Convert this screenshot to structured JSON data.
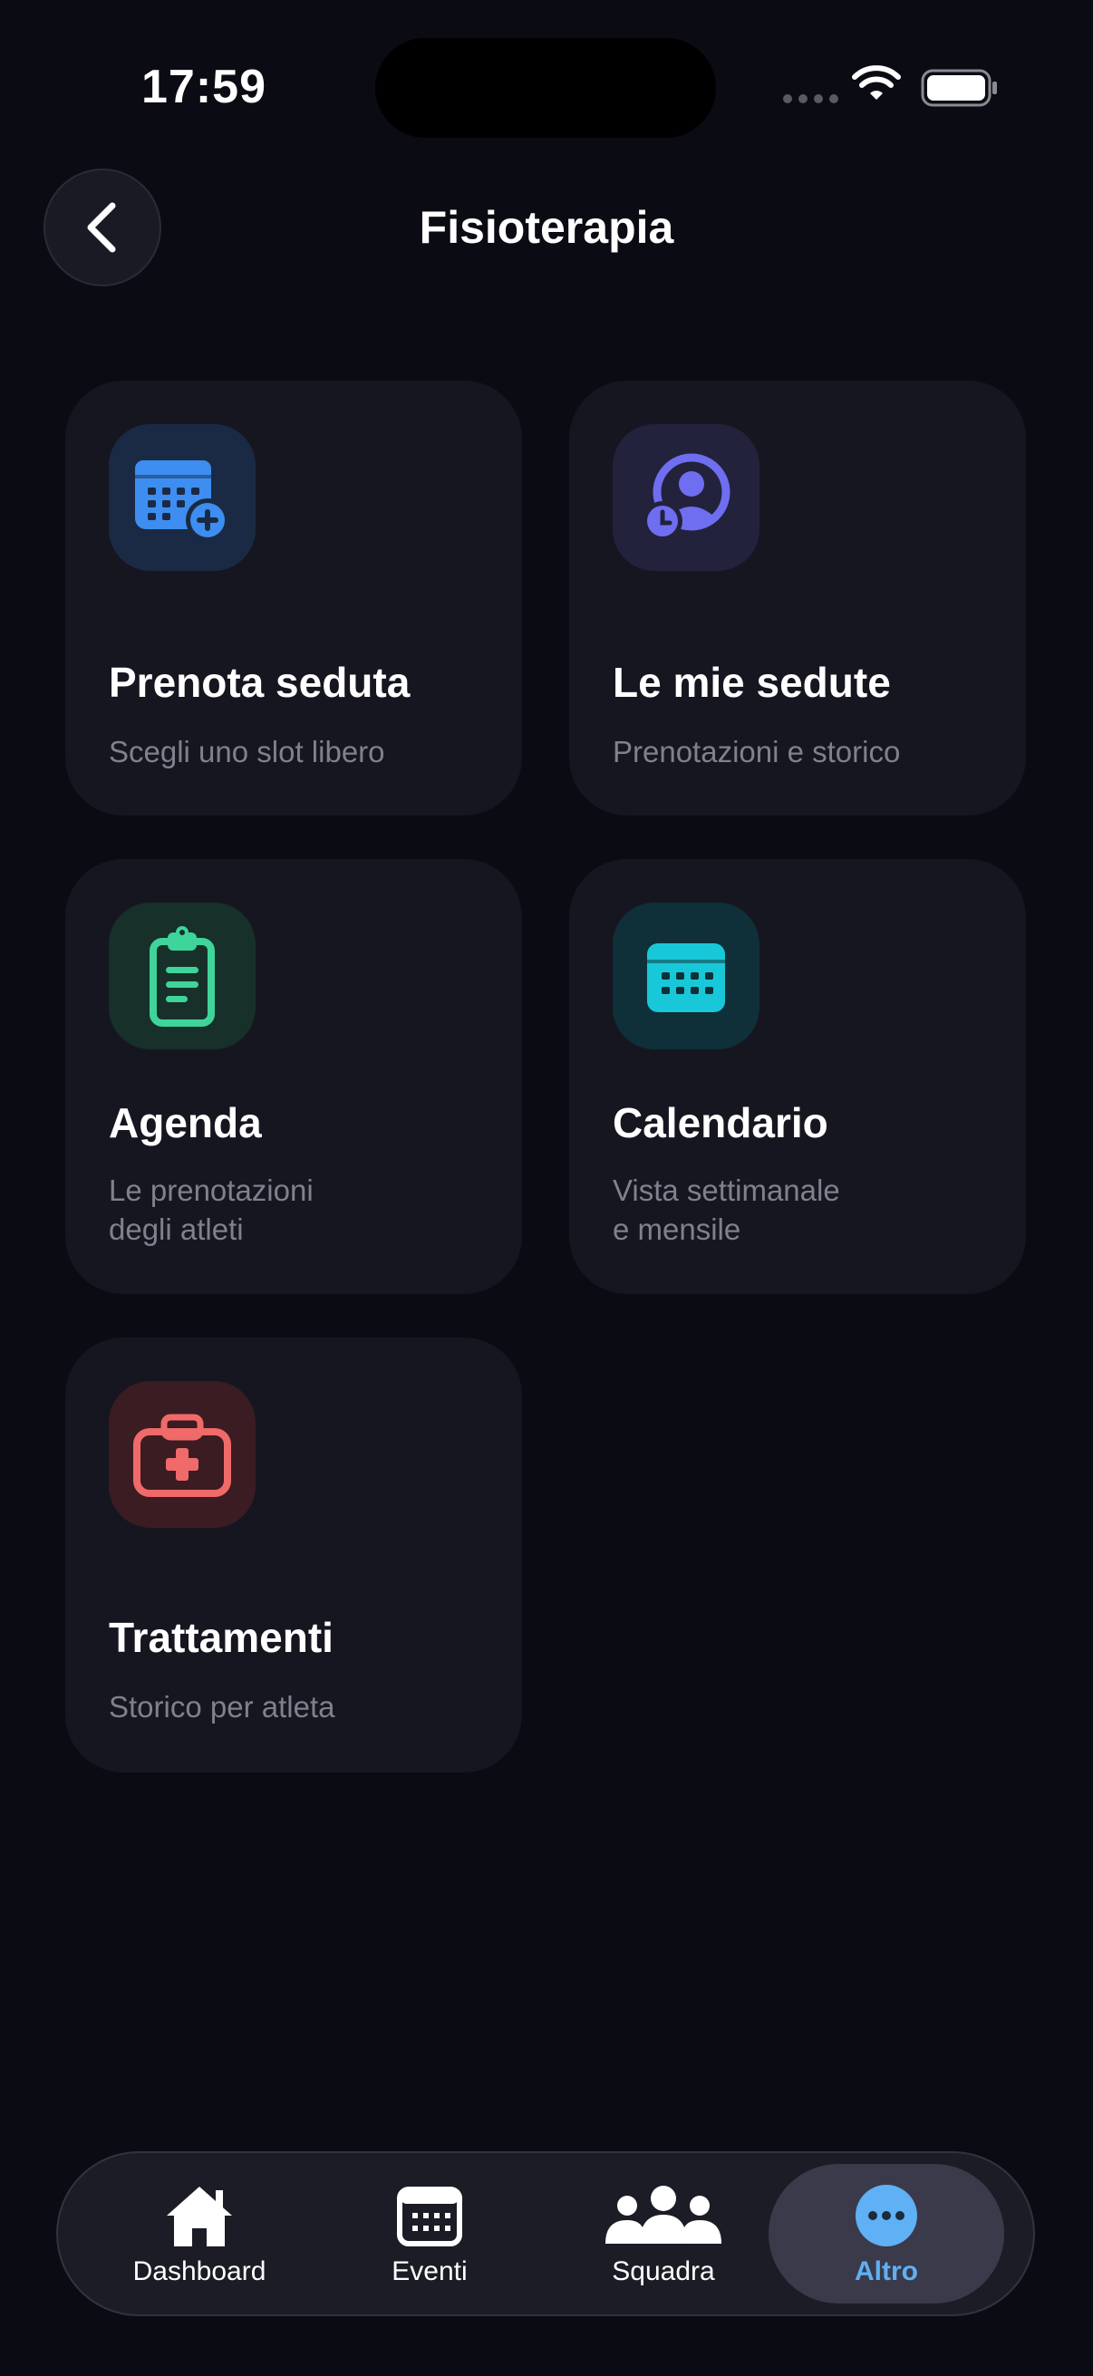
{
  "status_bar": {
    "time": "17:59"
  },
  "header": {
    "title": "Fisioterapia",
    "back_icon": "chevron-left-icon"
  },
  "cards": [
    {
      "title": "Prenota seduta",
      "subtitle": "Scegli uno slot libero",
      "icon": "calendar-plus-icon",
      "accent": "#3d8ef0"
    },
    {
      "title": "Le mie sedute",
      "subtitle": "Prenotazioni e storico",
      "icon": "user-clock-icon",
      "accent": "#6f6ef0"
    },
    {
      "title": "Agenda",
      "subtitle": "Le prenotazioni\ndegli atleti",
      "icon": "clipboard-icon",
      "accent": "#3ed49a"
    },
    {
      "title": "Calendario",
      "subtitle": "Vista settimanale\ne mensile",
      "icon": "calendar-icon",
      "accent": "#19c8d8"
    },
    {
      "title": "Trattamenti",
      "subtitle": "Storico per atleta",
      "icon": "medical-bag-icon",
      "accent": "#f06a6a"
    }
  ],
  "tab_bar": {
    "items": [
      {
        "label": "Dashboard",
        "icon": "home-icon",
        "active": false
      },
      {
        "label": "Eventi",
        "icon": "calendar-icon",
        "active": false
      },
      {
        "label": "Squadra",
        "icon": "team-icon",
        "active": false
      },
      {
        "label": "Altro",
        "icon": "more-icon",
        "active": true
      }
    ],
    "active_color": "#5fb0f5"
  }
}
